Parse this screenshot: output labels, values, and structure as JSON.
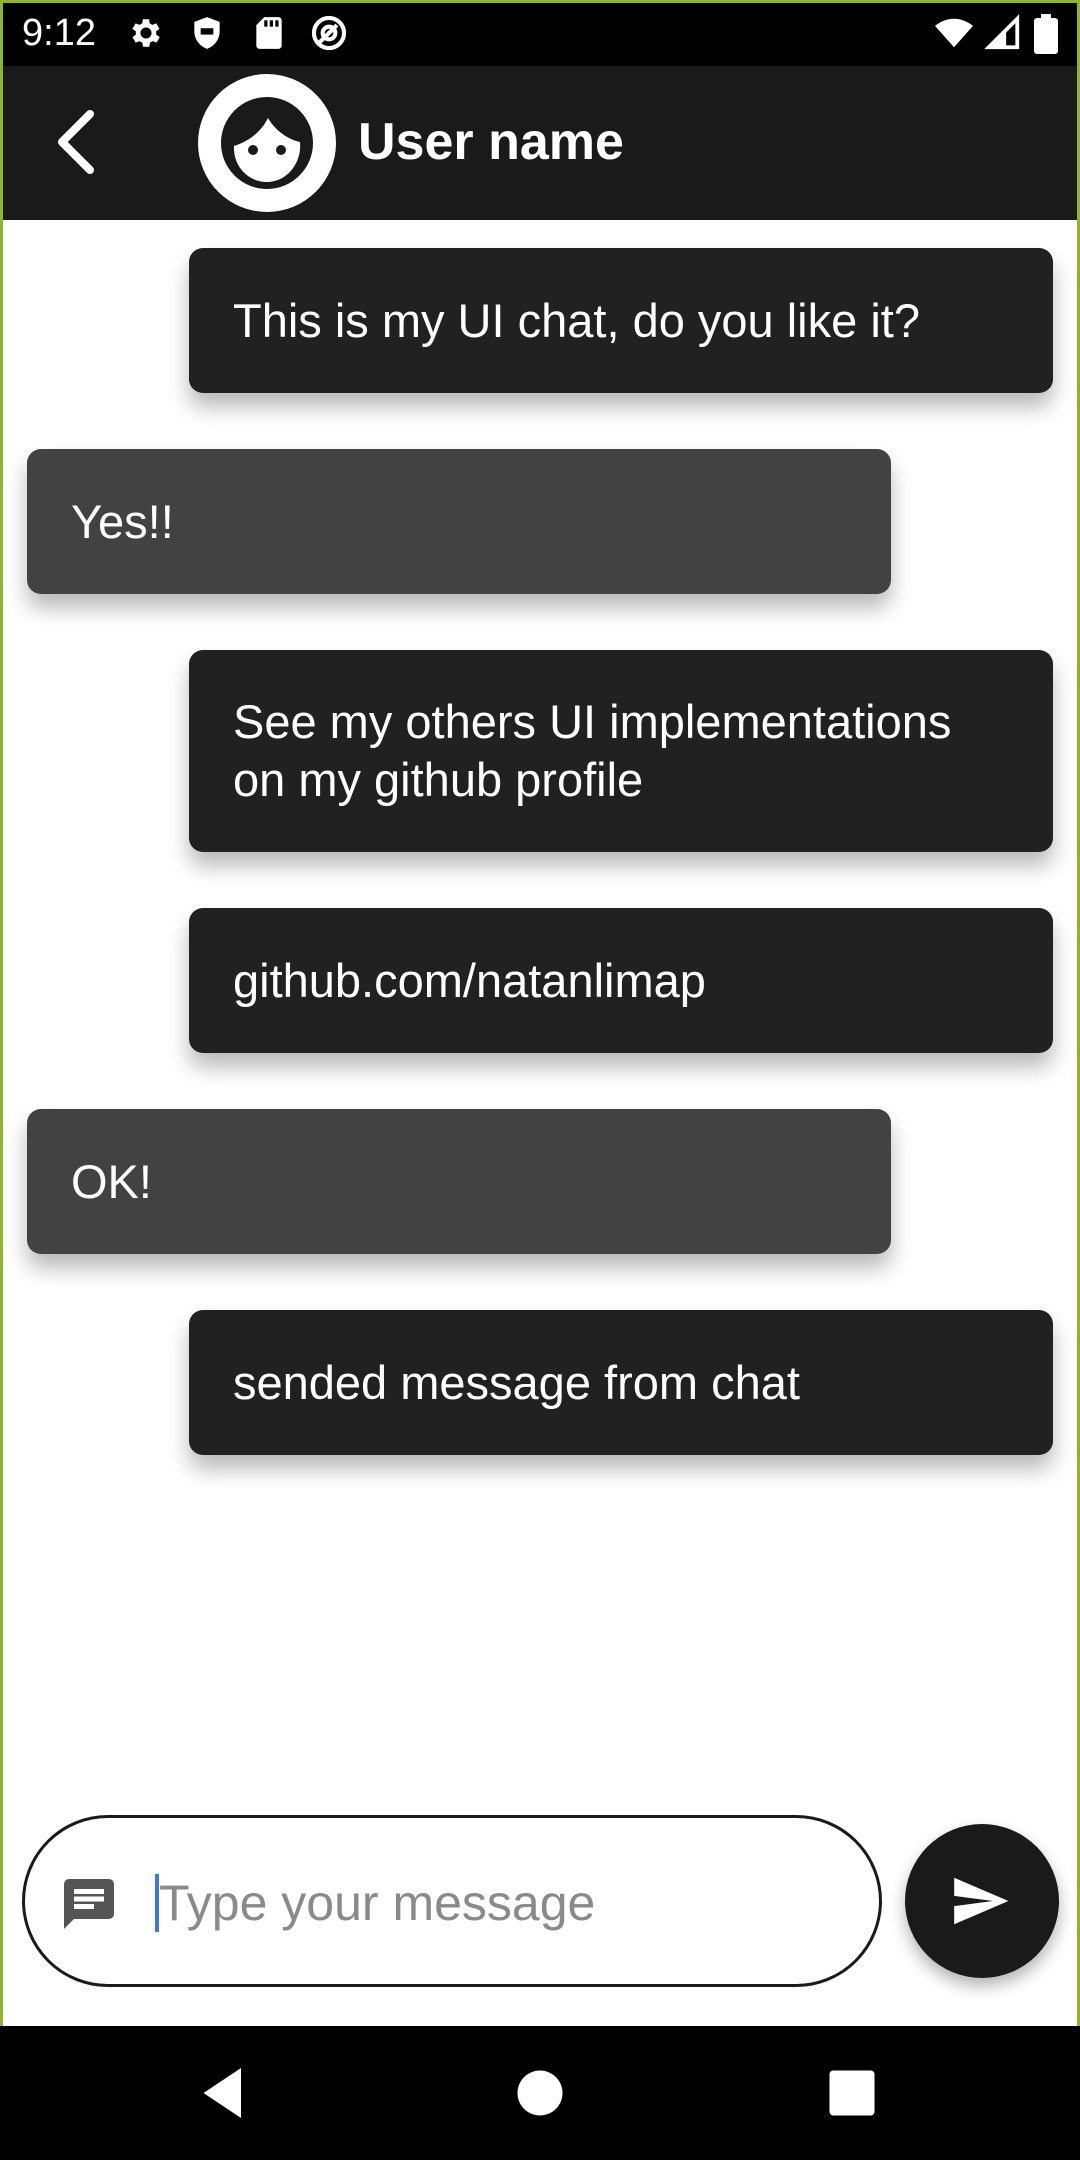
{
  "status_bar": {
    "time": "9:12",
    "left_icons": [
      "gear-icon",
      "shield-icon",
      "sd-card-icon",
      "at-sign-icon"
    ],
    "right_icons": [
      "wifi-icon",
      "cell-signal-icon",
      "battery-icon"
    ]
  },
  "header": {
    "back_icon": "chevron-left-icon",
    "avatar_icon": "face-avatar-icon",
    "title": "User name"
  },
  "messages": [
    {
      "from": "me",
      "text": "This is my UI chat, do you like it?"
    },
    {
      "from": "other",
      "text": "Yes!!"
    },
    {
      "from": "me",
      "text": "See my others UI implementations on my github profile"
    },
    {
      "from": "me",
      "text": "github.com/natanlimap"
    },
    {
      "from": "other",
      "text": "OK!"
    },
    {
      "from": "me",
      "text": "sended message from chat"
    }
  ],
  "composer": {
    "icon": "message-icon",
    "placeholder": "Type your message",
    "value": "",
    "send_icon": "send-icon"
  },
  "nav_bar": {
    "buttons": [
      "back-triangle-icon",
      "home-circle-icon",
      "recents-square-icon"
    ]
  },
  "colors": {
    "header_bg": "#1a1a1a",
    "sent_bubble": "#212121",
    "received_bubble": "#424242",
    "frame_border": "#8fb52a",
    "cursor": "#3a78e6"
  }
}
